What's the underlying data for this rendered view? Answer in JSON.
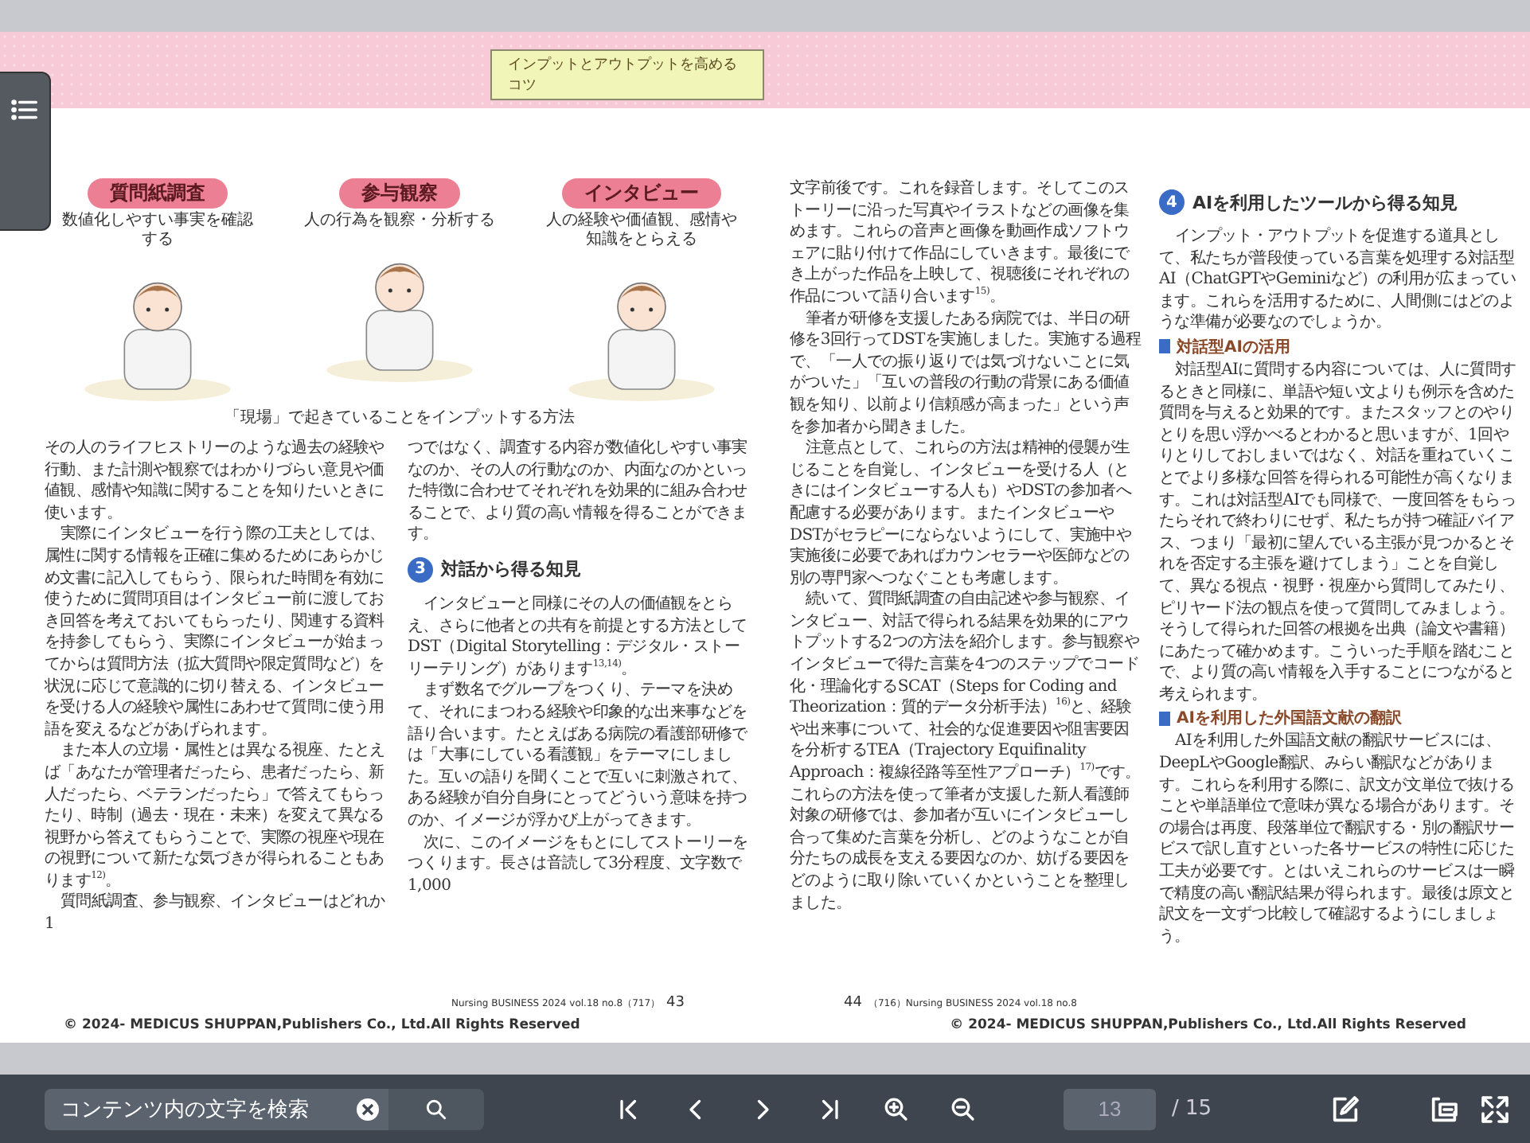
{
  "header_badge": "インプットとアウトプットを高めるコツ",
  "illustration": {
    "panels": [
      {
        "title": "質問紙調査",
        "caption": "数値化しやすい事実を確認する"
      },
      {
        "title": "参与観察",
        "caption": "人の行為を観察・分析する"
      },
      {
        "title": "インタビュー",
        "caption": "人の経験や価値観、感情や知識をとらえる"
      }
    ],
    "caption": "「現場」で起きていることをインプットする方法"
  },
  "left_page": {
    "columns": [
      [
        {
          "kind": "continuation",
          "text": "その人のライフヒストリーのような過去の経験や行動、また計測や観察ではわかりづらい意見や価値観、感情や知識に関することを知りたいときに使います。"
        },
        {
          "kind": "paragraph",
          "text": "実際にインタビューを行う際の工夫としては、属性に関する情報を正確に集めるためにあらかじめ文書に記入してもらう、限られた時間を有効に使うために質問項目はインタビュー前に渡しておき回答を考えておいてもらったり、関連する資料を持参してもらう、実際にインタビューが始まってからは質問方法（拡大質問や限定質問など）を状況に応じて意識的に切り替える、インタビューを受ける人の経験や属性にあわせて質問に使う用語を変えるなどがあげられます。"
        },
        {
          "kind": "paragraph",
          "text": "また本人の立場・属性とは異なる視座、たとえば「あなたが管理者だったら、患者だったら、新人だったら、ベテランだったら」で答えてもらったり、時制（過去・現在・未来）を変えて異なる視野から答えてもらうことで、実際の視座や現在の視野について新たな気づきが得られることもあります$^{12)}$。"
        },
        {
          "kind": "paragraph",
          "text": "質問紙調査、参与観察、インタビューはどれか1"
        }
      ],
      [
        {
          "kind": "continuation",
          "text": "つではなく、調査する内容が数値化しやすい事実なのか、その人の行動なのか、内面なのかといった特徴に合わせてそれぞれを効果的に組み合わせることで、より質の高い情報を得ることができます。"
        },
        {
          "kind": "heading",
          "number": "3",
          "text": "対話から得る知見"
        },
        {
          "kind": "paragraph",
          "text": "インタビューと同様にその人の価値観をとらえ、さらに他者との共有を前提とする方法としてDST（Digital Storytelling：デジタル・ストーリーテリング）があります$^{13,14)}$。"
        },
        {
          "kind": "paragraph",
          "text": "まず数名でグループをつくり、テーマを決めて、それにまつわる経験や印象的な出来事などを語り合います。たとえばある病院の看護部研修では「大事にしている看護観」をテーマにしました。互いの語りを聞くことで互いに刺激されて、ある経験が自分自身にとってどういう意味を持つのか、イメージが浮かび上がってきます。"
        },
        {
          "kind": "paragraph",
          "text": "次に、このイメージをもとにしてストーリーをつくります。長さは音読して3分程度、文字数で1,000"
        }
      ]
    ],
    "footer": {
      "journal": "Nursing BUSINESS 2024 vol.18 no.8（717）",
      "page_number": "43",
      "copyright": "© 2024- MEDICUS SHUPPAN,Publishers Co., Ltd.All Rights Reserved"
    }
  },
  "right_page": {
    "columns": [
      [
        {
          "kind": "continuation",
          "text": "文字前後です。これを録音します。そしてこのストーリーに沿った写真やイラストなどの画像を集めます。これらの音声と画像を動画作成ソフトウェアに貼り付けて作品にしていきます。最後にでき上がった作品を上映して、視聴後にそれぞれの作品について語り合います$^{15)}$。"
        },
        {
          "kind": "paragraph",
          "text": "筆者が研修を支援したある病院では、半日の研修を3回行ってDSTを実施しました。実施する過程で、「一人での振り返りでは気づけないことに気がついた」「互いの普段の行動の背景にある価値観を知り、以前より信頼感が高まった」という声を参加者から聞きました。"
        },
        {
          "kind": "paragraph",
          "text": "注意点として、これらの方法は精神的侵襲が生じることを自覚し、インタビューを受ける人（ときにはインタビューする人も）やDSTの参加者へ配慮する必要があります。またインタビューやDSTがセラピーにならないようにして、実施中や実施後に必要であればカウンセラーや医師などの別の専門家へつなぐことも考慮します。"
        },
        {
          "kind": "paragraph",
          "text": "続いて、質問紙調査の自由記述や参与観察、インタビュー、対話で得られる結果を効果的にアウトプットする2つの方法を紹介します。参与観察やインタビューで得た言葉を4つのステップでコード化・理論化するSCAT（Steps for Coding and Theorization：質的データ分析手法）$^{16)}$と、経験や出来事について、社会的な促進要因や阻害要因を分析するTEA（Trajectory Equifinality Approach：複線径路等至性アプローチ）$^{17)}$です。これらの方法を使って筆者が支援した新人看護師対象の研修では、参加者が互いにインタビューし合って集めた言葉を分析し、どのようなことが自分たちの成長を支える要因なのか、妨げる要因をどのように取り除いていくかということを整理しました。"
        }
      ],
      [
        {
          "kind": "heading",
          "number": "4",
          "text": "AIを利用したツールから得る知見"
        },
        {
          "kind": "paragraph",
          "text": "インプット・アウトプットを促進する道具として、私たちが普段使っている言葉を処理する対話型AI（ChatGPTやGeminiなど）の利用が広まっています。これらを活用するために、人間側にはどのような準備が必要なのでしょうか。"
        },
        {
          "kind": "subheading",
          "text": "対話型AIの活用"
        },
        {
          "kind": "paragraph",
          "text": "対話型AIに質問する内容については、人に質問するときと同様に、単語や短い文よりも例示を含めた質問を与えると効果的です。またスタッフとのやりとりを思い浮かべるとわかると思いますが、1回やりとりしておしまいではなく、対話を重ねていくことでより多様な回答を得られる可能性が高くなります。これは対話型AIでも同様で、一度回答をもらったらそれで終わりにせず、私たちが持つ確証バイアス、つまり「最初に望んでいる主張が見つかるとそれを否定する主張を避けてしまう」ことを自覚して、異なる視点・視野・視座から質問してみたり、ピリヤード法の観点を使って質問してみましょう。そうして得られた回答の根拠を出典（論文や書籍）にあたって確かめます。こういった手順を踏むことで、より質の高い情報を入手することにつながると考えられます。"
        },
        {
          "kind": "subheading",
          "text": "AIを利用した外国語文献の翻訳"
        },
        {
          "kind": "paragraph",
          "text": "AIを利用した外国語文献の翻訳サービスには、DeepLやGoogle翻訳、みらい翻訳などがあります。これらを利用する際に、訳文が文単位で抜けることや単語単位で意味が異なる場合があります。その場合は再度、段落単位で翻訳する・別の翻訳サービスで訳し直すといった各サービスの特性に応じた工夫が必要です。とはいえこれらのサービスは一瞬で精度の高い翻訳結果が得られます。最後は原文と訳文を一文ずつ比較して確認するようにしましょう。"
        }
      ]
    ],
    "footer": {
      "page_number": "44",
      "journal": "（716）Nursing BUSINESS 2024 vol.18 no.8",
      "copyright": "© 2024- MEDICUS SHUPPAN,Publishers Co., Ltd.All Rights Reserved"
    }
  },
  "toolbar": {
    "search": {
      "placeholder": "コンテンツ内の文字を検索"
    },
    "page_input": "13",
    "page_total": "/ 15"
  }
}
